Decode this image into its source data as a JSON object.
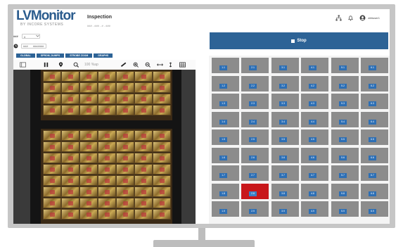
{
  "header": {
    "logo_text": "LVMonitor",
    "logo_subtitle": "BY INCORE SYSTEMS",
    "title": "Inspection",
    "subtitle": "### - ### - # - ###",
    "user": "###user1"
  },
  "controls": {
    "row1_label": "###",
    "row1_value": "#",
    "row2_value": "###",
    "row2_unit": "#######"
  },
  "view_tabs": [
    "GLOBAL",
    "SPROM_DUMPS",
    "STROBE ZOOM",
    "GRAPHS"
  ],
  "toolbar": {
    "zoom_value": "100 %ap",
    "icons": [
      "layout-icon",
      "pause-icon",
      "pin-icon",
      "zoom-icon",
      "ruler-icon",
      "zoom-in-icon",
      "zoom-out-icon",
      "fit-width-icon",
      "fit-height-icon",
      "grid-icon"
    ]
  },
  "stop_button": {
    "label": "Stop"
  },
  "inspection_grid": {
    "columns": 6,
    "rows": [
      [
        "1.1",
        "2.1",
        "3.1",
        "4.1",
        "5.1",
        "6.1"
      ],
      [
        "1.2",
        "2.2",
        "3.2",
        "4.2",
        "5.2",
        "6.2"
      ],
      [
        "1.3",
        "2.3",
        "3.3",
        "4.3",
        "5.3",
        "6.3"
      ],
      [
        "1.4",
        "2.4",
        "3.4",
        "4.4",
        "5.4",
        "6.4"
      ],
      [
        "1.5",
        "2.5",
        "3.5",
        "4.5",
        "5.5",
        "6.5"
      ],
      [
        "1.6",
        "2.6",
        "3.6",
        "4.6",
        "5.6",
        "6.6"
      ],
      [
        "1.7",
        "2.7",
        "3.7",
        "4.7",
        "5.7",
        "6.7"
      ],
      [
        "1.8",
        "2.8",
        "3.8",
        "4.8",
        "5.8",
        "6.8"
      ],
      [
        "1.9",
        "2.9",
        "3.9",
        "4.9",
        "5.9",
        "6.9"
      ]
    ],
    "defect_cells": [
      "2.8"
    ],
    "colors": {
      "ok": "#8c8c8c",
      "defect": "#c8171b",
      "label": "#2d6fb5"
    }
  },
  "colors": {
    "primary": "#2d6396",
    "bezel": "#c6c6c6"
  }
}
